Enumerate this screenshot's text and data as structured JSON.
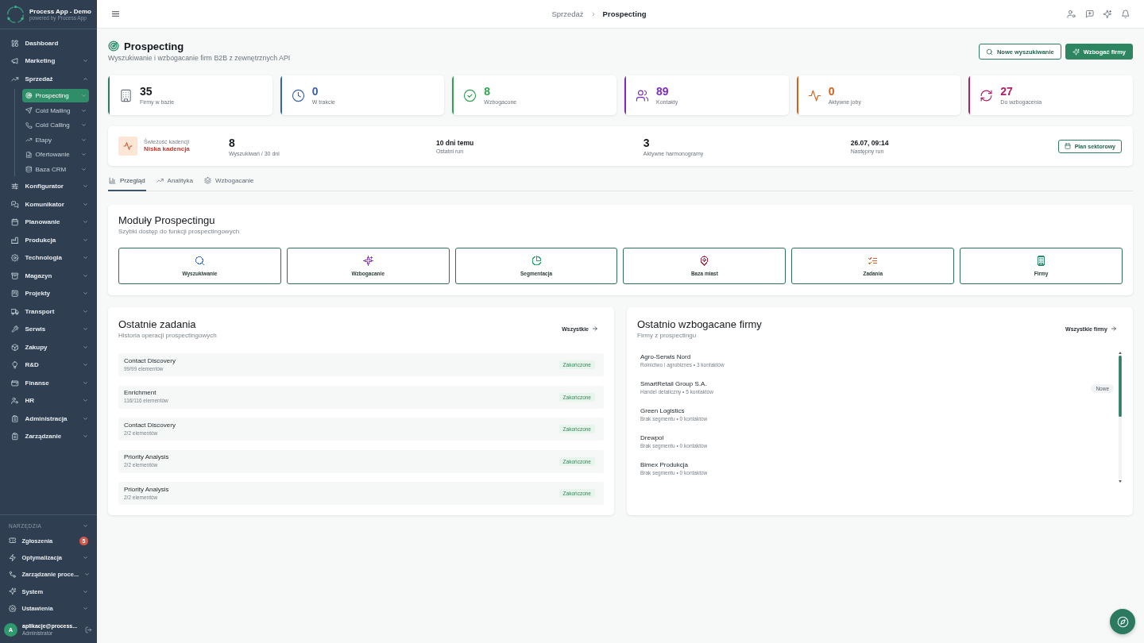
{
  "app": {
    "name": "Process App - Demo",
    "tagline": "powered by Process App"
  },
  "sidebar": {
    "items": [
      {
        "label": "Dashboard",
        "selected": false
      },
      {
        "label": "Marketing",
        "selected": false,
        "expanded": false
      },
      {
        "label": "Sprzedaż",
        "selected": false,
        "expanded": true,
        "children": [
          {
            "label": "Prospecting",
            "selected": true,
            "expanded": false
          },
          {
            "label": "Cold Mailing",
            "selected": false,
            "expanded": false
          },
          {
            "label": "Cold Calling",
            "selected": false,
            "expanded": false
          },
          {
            "label": "Etapy",
            "selected": false,
            "expanded": false
          },
          {
            "label": "Ofertowanie",
            "selected": false,
            "expanded": false
          },
          {
            "label": "Baza CRM",
            "selected": false,
            "expanded": false
          }
        ]
      },
      {
        "label": "Konfigurator",
        "selected": false,
        "expanded": false
      },
      {
        "label": "Komunikator",
        "selected": false,
        "expanded": false
      },
      {
        "label": "Planowanie",
        "selected": false,
        "expanded": false
      },
      {
        "label": "Produkcja",
        "selected": false,
        "expanded": false
      },
      {
        "label": "Technologia",
        "selected": false,
        "expanded": false
      },
      {
        "label": "Magazyn",
        "selected": false,
        "expanded": false
      },
      {
        "label": "Projekty",
        "selected": false,
        "expanded": false
      },
      {
        "label": "Transport",
        "selected": false,
        "expanded": false
      },
      {
        "label": "Serwis",
        "selected": false,
        "expanded": false
      },
      {
        "label": "Zakupy",
        "selected": false,
        "expanded": false
      },
      {
        "label": "R&D",
        "selected": false,
        "expanded": false
      },
      {
        "label": "Finanse",
        "selected": false,
        "expanded": false
      },
      {
        "label": "HR",
        "selected": false,
        "expanded": false
      },
      {
        "label": "Administracja",
        "selected": false,
        "expanded": false
      },
      {
        "label": "Zarządzanie",
        "selected": false,
        "expanded": false
      }
    ],
    "tools": {
      "title": "NARZĘDZIA",
      "items": [
        {
          "label": "Zgłoszenia",
          "selected": false,
          "badge": "5"
        },
        {
          "label": "Optymalizacja",
          "selected": false,
          "expanded": false
        },
        {
          "label": "Zarządzanie proce...",
          "selected": false,
          "expanded": false
        },
        {
          "label": "System",
          "selected": false,
          "expanded": false
        },
        {
          "label": "Ustawienia",
          "selected": false,
          "expanded": false
        }
      ]
    },
    "user": {
      "initial": "A",
      "name": "aplikacje@process...",
      "role": "Administrator"
    }
  },
  "topbar": {
    "breadcrumb": [
      {
        "label": "Sprzedaż",
        "current": false
      },
      {
        "label": "Prospecting",
        "current": true
      }
    ]
  },
  "page": {
    "title": "Prospecting",
    "subtitle": "Wyszukiwanie i wzbogacanie firm B2B z zewnętrznych API",
    "actions": [
      {
        "label": "Nowe wyszukiwanie",
        "kind": "outline"
      },
      {
        "label": "Wzbogać firmy",
        "kind": "primary"
      }
    ]
  },
  "stats": [
    {
      "value": "35",
      "label": "Firmy w bazie",
      "kind": "neutral",
      "color": "#2a7d5f"
    },
    {
      "value": "0",
      "label": "W trakcie",
      "kind": "accent",
      "color": "#3a62a8"
    },
    {
      "value": "8",
      "label": "Wzbogacone",
      "kind": "accent",
      "color": "#2fa350"
    },
    {
      "value": "89",
      "label": "Kontakty",
      "kind": "accent",
      "color": "#7b2cbf"
    },
    {
      "value": "0",
      "label": "Aktywne joby",
      "kind": "accent",
      "color": "#d35f1f"
    },
    {
      "value": "27",
      "label": "Do wzbogacenia",
      "kind": "accent",
      "color": "#ad1f68"
    }
  ],
  "cadence": {
    "label": "Świeżość kadencji",
    "status": "Niska kadencja",
    "metrics": [
      {
        "value": "8",
        "label": "Wyszukiwań / 30 dni",
        "kind": "count"
      },
      {
        "value": "10 dni temu",
        "label": "Ostatni run",
        "kind": "date"
      },
      {
        "value": "3",
        "label": "Aktywne harmonogramy",
        "kind": "count"
      },
      {
        "value": "26.07, 09:14",
        "label": "Następny run",
        "kind": "date"
      }
    ],
    "button": "Plan sektorowy"
  },
  "tabs": [
    {
      "label": "Przegląd",
      "selected": true
    },
    {
      "label": "Analityka",
      "selected": false
    },
    {
      "label": "Wzbogacanie",
      "selected": false
    }
  ],
  "modules": {
    "title": "Moduły Prospectingu",
    "subtitle": "Szybki dostęp do funkcji prospectingowych",
    "items": [
      {
        "label": "Wyszukiwanie",
        "color": "#3b6fc9"
      },
      {
        "label": "Wzbogacanie",
        "color": "#8a3fd1"
      },
      {
        "label": "Segmentacja",
        "color": "#2fa36b"
      },
      {
        "label": "Baza miast",
        "color": "#b0243f"
      },
      {
        "label": "Zadania",
        "color": "#d9622b"
      },
      {
        "label": "Firmy",
        "color": "#2b8a6a"
      }
    ]
  },
  "recent_tasks": {
    "title": "Ostatnie zadania",
    "subtitle": "Historia operacji prospectingowych",
    "link": "Wszystkie",
    "rows": [
      {
        "name": "Contact Discovery",
        "items": "99/99 elementów",
        "status": "Zakończone"
      },
      {
        "name": "Enrichment",
        "items": "116/116 elementów",
        "status": "Zakończone"
      },
      {
        "name": "Contact Discovery",
        "items": "2/2 elementów",
        "status": "Zakończone"
      },
      {
        "name": "Priority Analysis",
        "items": "2/2 elementów",
        "status": "Zakończone"
      },
      {
        "name": "Priority Analysis",
        "items": "2/2 elementów",
        "status": "Zakończone"
      }
    ]
  },
  "recent_companies": {
    "title": "Ostatnio wzbogacane firmy",
    "subtitle": "Firmy z prospectingu",
    "link": "Wszystkie firmy",
    "rows": [
      {
        "name": "Agro-Serwis Nord",
        "details": "Rolnictwo i agrobiznes • 3 kontaktów"
      },
      {
        "name": "SmartRetail Group S.A.",
        "details": "Handel detaliczny • 5 kontaktów",
        "badge": "Nowe"
      },
      {
        "name": "Green Logistics",
        "details": "Brak segmentu • 0 kontaktów"
      },
      {
        "name": "Drewpol",
        "details": "Brak segmentu • 0 kontaktów"
      },
      {
        "name": "Bimex Produkcja",
        "details": "Brak segmentu • 0 kontaktów"
      }
    ]
  }
}
